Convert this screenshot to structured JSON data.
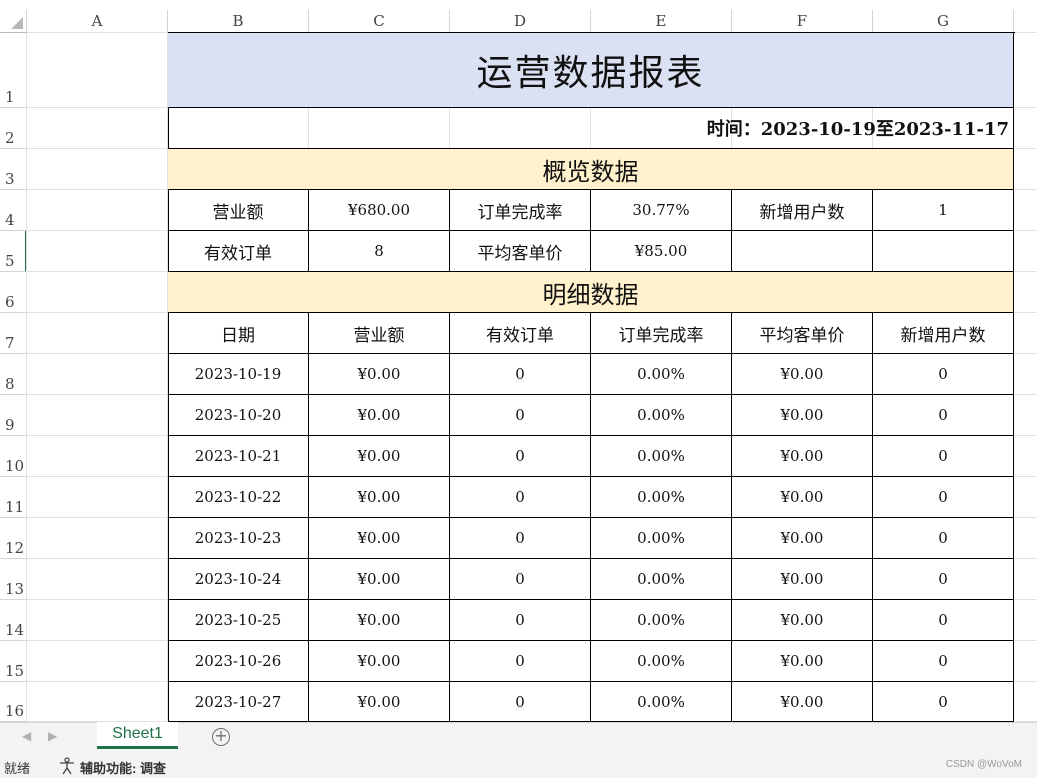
{
  "columns": [
    "A",
    "B",
    "C",
    "D",
    "E",
    "F",
    "G"
  ],
  "rows": [
    "1",
    "2",
    "3",
    "4",
    "5",
    "6",
    "7",
    "8",
    "9",
    "10",
    "11",
    "12",
    "13",
    "14",
    "15",
    "16"
  ],
  "report": {
    "title": "运营数据报表",
    "period": "时间：2023-10-19至2023-11-17",
    "overview_header": "概览数据",
    "overview": [
      [
        "营业额",
        "¥680.00",
        "订单完成率",
        "30.77%",
        "新增用户数",
        "1"
      ],
      [
        "有效订单",
        "8",
        "平均客单价",
        "¥85.00",
        "",
        ""
      ]
    ],
    "detail_header": "明细数据",
    "detail_columns": [
      "日期",
      "营业额",
      "有效订单",
      "订单完成率",
      "平均客单价",
      "新增用户数"
    ],
    "detail_rows": [
      [
        "2023-10-19",
        "¥0.00",
        "0",
        "0.00%",
        "¥0.00",
        "0"
      ],
      [
        "2023-10-20",
        "¥0.00",
        "0",
        "0.00%",
        "¥0.00",
        "0"
      ],
      [
        "2023-10-21",
        "¥0.00",
        "0",
        "0.00%",
        "¥0.00",
        "0"
      ],
      [
        "2023-10-22",
        "¥0.00",
        "0",
        "0.00%",
        "¥0.00",
        "0"
      ],
      [
        "2023-10-23",
        "¥0.00",
        "0",
        "0.00%",
        "¥0.00",
        "0"
      ],
      [
        "2023-10-24",
        "¥0.00",
        "0",
        "0.00%",
        "¥0.00",
        "0"
      ],
      [
        "2023-10-25",
        "¥0.00",
        "0",
        "0.00%",
        "¥0.00",
        "0"
      ],
      [
        "2023-10-26",
        "¥0.00",
        "0",
        "0.00%",
        "¥0.00",
        "0"
      ],
      [
        "2023-10-27",
        "¥0.00",
        "0",
        "0.00%",
        "¥0.00",
        "0"
      ]
    ]
  },
  "tabs": {
    "sheet1": "Sheet1",
    "add_icon": "plus-circle-icon"
  },
  "status": {
    "ready": "就绪",
    "accessibility": "辅助功能: 调查",
    "watermark": "CSDN @WoVoM"
  },
  "colors": {
    "title_fill": "#d9e1f2",
    "section_fill": "#fff2cc",
    "accent": "#217346"
  }
}
